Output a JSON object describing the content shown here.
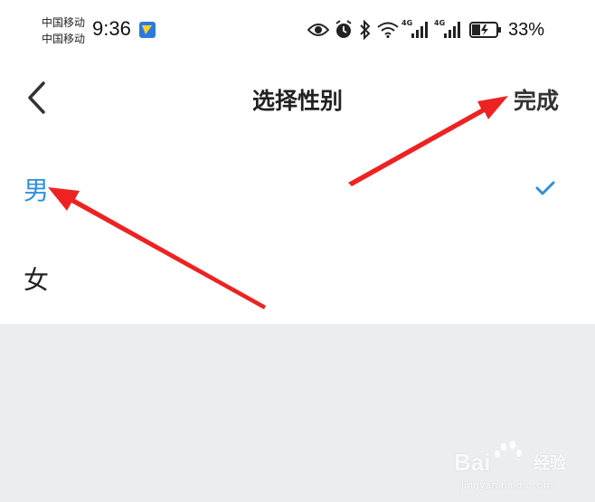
{
  "status_bar": {
    "carrier_1": "中国移动",
    "carrier_2": "中国移动",
    "time": "9:36",
    "network_label_1": "4G",
    "network_label_2": "4G",
    "battery_percent": "33%",
    "battery_level": 0.33,
    "icons": [
      "app-notification-icon",
      "eye-icon",
      "alarm-icon",
      "bluetooth-icon",
      "wifi-icon",
      "signal-icon",
      "signal-icon",
      "battery-icon"
    ]
  },
  "navbar": {
    "title": "选择性别",
    "done_label": "完成",
    "back_icon": "chevron-left-icon"
  },
  "options": [
    {
      "label": "男",
      "selected": true
    },
    {
      "label": "女",
      "selected": false
    }
  ],
  "colors": {
    "accent": "#2f8fde",
    "background_gray": "#ebedef",
    "annotation_arrow": "#ee2222"
  },
  "watermark": {
    "brand": "Bai",
    "sub": "经验",
    "url": "jingyan.baidu.com"
  }
}
